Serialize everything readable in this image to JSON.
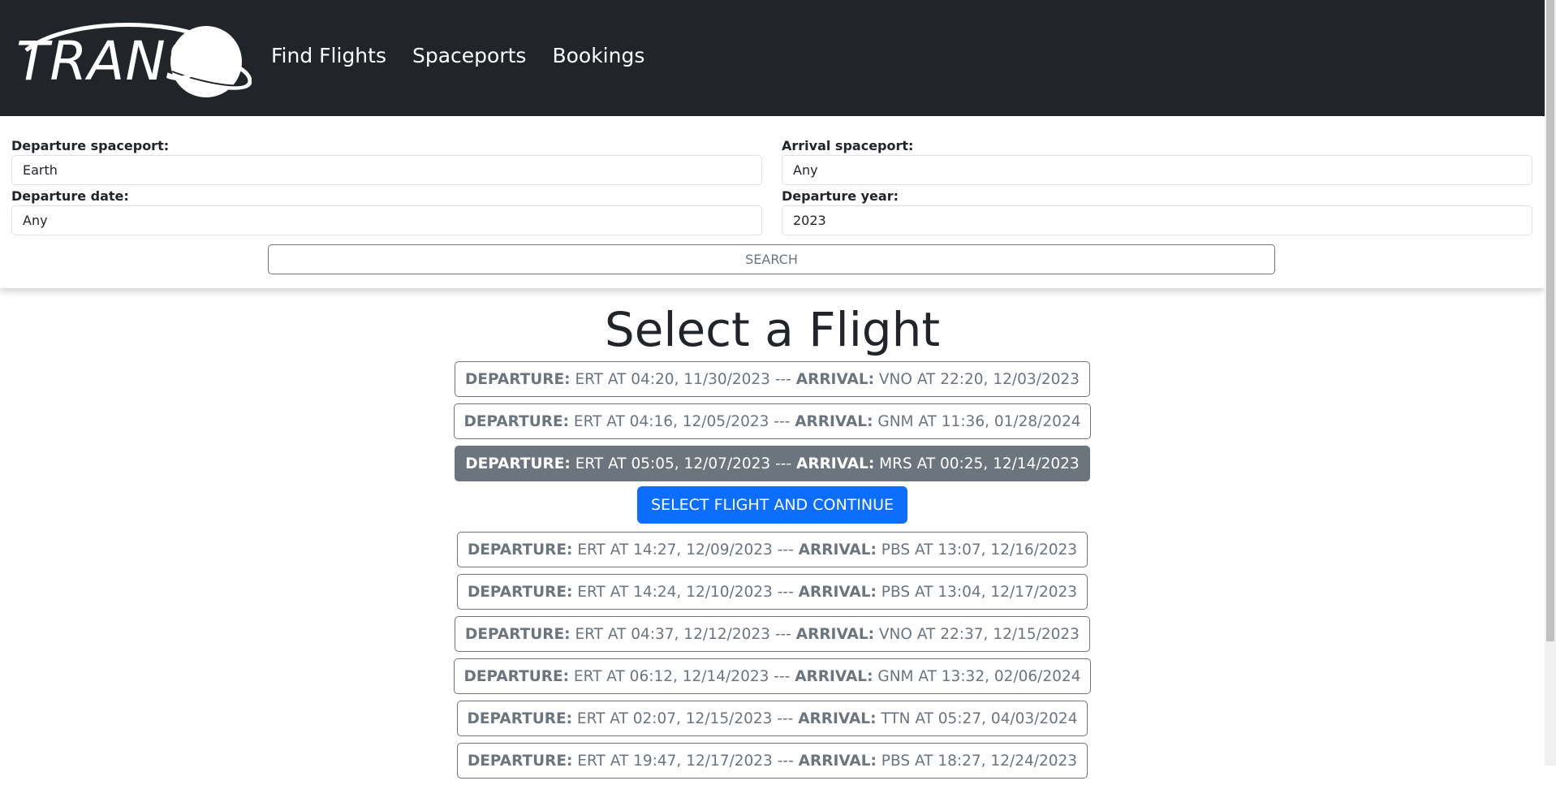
{
  "nav": {
    "logo_text": "TRANS",
    "links": [
      "Find Flights",
      "Spaceports",
      "Bookings"
    ]
  },
  "search": {
    "departure_spaceport_label": "Departure spaceport:",
    "departure_spaceport_value": "Earth",
    "arrival_spaceport_label": "Arrival spaceport:",
    "arrival_spaceport_value": "Any",
    "departure_date_label": "Departure date:",
    "departure_date_value": "Any",
    "departure_year_label": "Departure year:",
    "departure_year_value": "2023",
    "search_button": "SEARCH"
  },
  "main": {
    "title": "Select a Flight",
    "continue_button": "SELECT FLIGHT AND CONTINUE",
    "dep_label": "DEPARTURE:",
    "arr_label": "ARRIVAL:",
    "separator": "---",
    "flights": [
      {
        "dep": "ERT AT 04:20, 11/30/2023",
        "arr": "VNO AT 22:20, 12/03/2023"
      },
      {
        "dep": "ERT AT 04:16, 12/05/2023",
        "arr": "GNM AT 11:36, 01/28/2024"
      },
      {
        "dep": "ERT AT 05:05, 12/07/2023",
        "arr": "MRS AT 00:25, 12/14/2023",
        "selected": true
      },
      {
        "dep": "ERT AT 14:27, 12/09/2023",
        "arr": "PBS AT 13:07, 12/16/2023"
      },
      {
        "dep": "ERT AT 14:24, 12/10/2023",
        "arr": "PBS AT 13:04, 12/17/2023"
      },
      {
        "dep": "ERT AT 04:37, 12/12/2023",
        "arr": "VNO AT 22:37, 12/15/2023"
      },
      {
        "dep": "ERT AT 06:12, 12/14/2023",
        "arr": "GNM AT 13:32, 02/06/2024"
      },
      {
        "dep": "ERT AT 02:07, 12/15/2023",
        "arr": "TTN AT 05:27, 04/03/2024"
      },
      {
        "dep": "ERT AT 19:47, 12/17/2023",
        "arr": "PBS AT 18:27, 12/24/2023"
      }
    ]
  },
  "colors": {
    "navbar": "#212529",
    "secondary": "#6c757d",
    "primary": "#0d6efd"
  }
}
